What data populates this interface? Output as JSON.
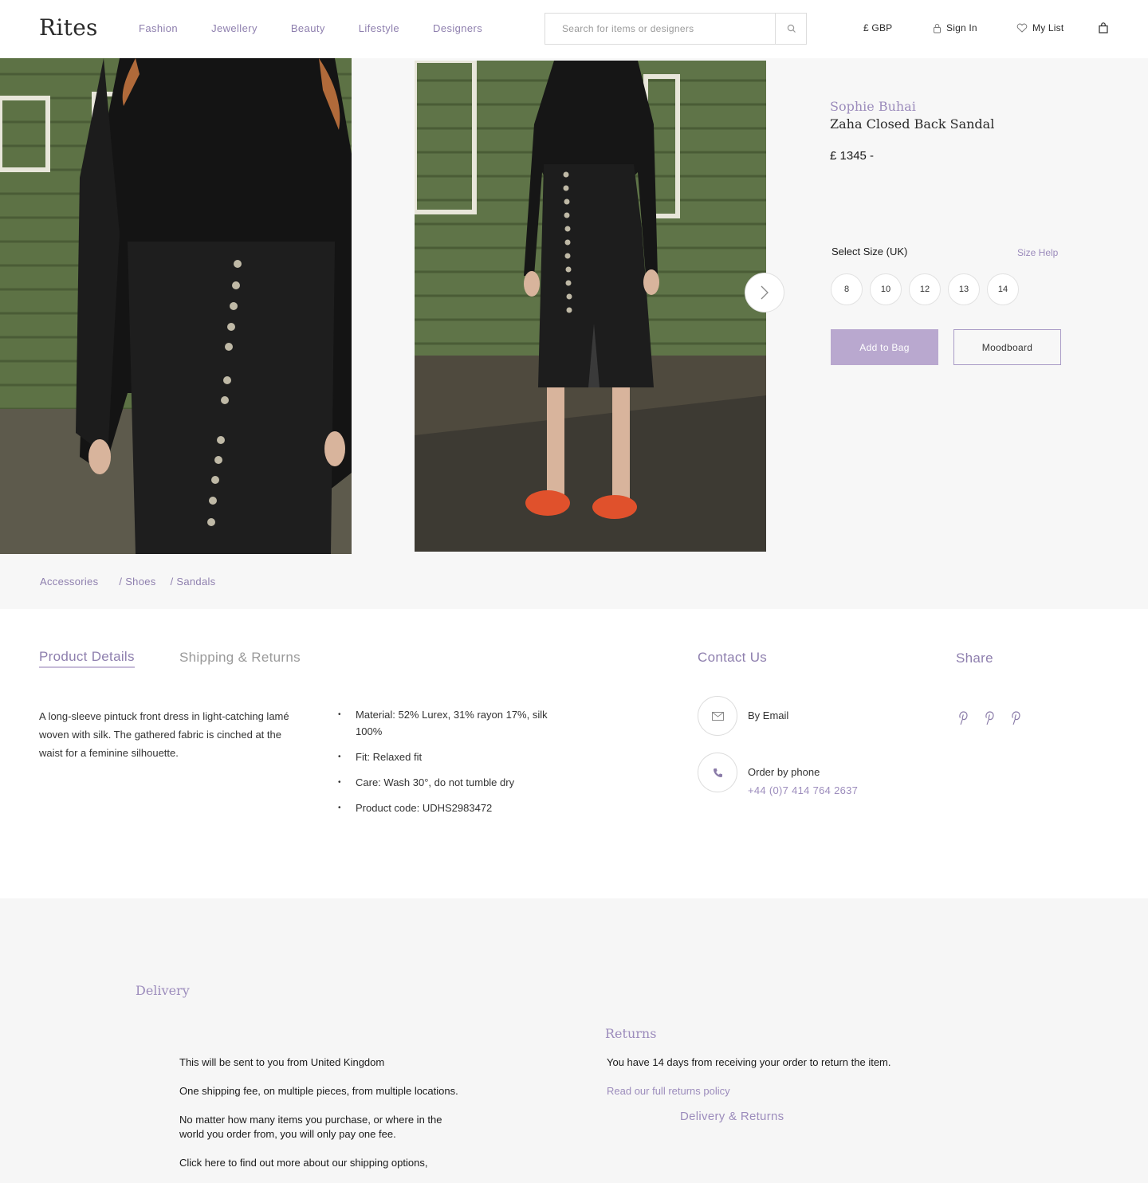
{
  "header": {
    "logo": "Rites",
    "nav": [
      "Fashion",
      "Jewellery",
      "Beauty",
      "Lifestyle",
      "Designers"
    ],
    "search_placeholder": "Search for items or designers",
    "currency": "£ GBP",
    "sign_in": "Sign In",
    "my_list": "My List"
  },
  "product": {
    "designer": "Sophie Buhai",
    "name": "Zaha Closed Back Sandal",
    "price": "£ 1345 -",
    "size_label": "Select Size (UK)",
    "size_help": "Size Help",
    "sizes": [
      "8",
      "10",
      "12",
      "13",
      "14"
    ],
    "add_to_bag": "Add to Bag",
    "moodboard": "Moodboard"
  },
  "breadcrumb": [
    "Accessories",
    "/ Shoes",
    "/ Sandals"
  ],
  "details": {
    "tab_active": "Product Details",
    "tab_other": "Shipping & Returns",
    "description": "A long-sleeve pintuck front dress in light-catching lamé woven with silk. The gathered fabric is cinched at the waist for a feminine silhouette.",
    "bullets": [
      "Material: 52% Lurex, 31% rayon 17%, silk 100%",
      "Fit:  Relaxed fit",
      "Care: Wash 30°, do not tumble dry",
      "Product code: UDHS2983472"
    ]
  },
  "contact": {
    "heading": "Contact Us",
    "email": "By Email",
    "phone_label": "Order by phone",
    "phone_number": "+44 (0)7 414 764 2637"
  },
  "share": {
    "heading": "Share",
    "icons": [
      "pinterest-icon",
      "pinterest-icon",
      "pinterest-icon"
    ]
  },
  "delivery": {
    "heading": "Delivery",
    "paragraphs": [
      "This will be sent to you from United Kingdom",
      "One shipping fee, on multiple pieces, from multiple locations.",
      "No matter how many items you purchase, or where in the world you order from, you will only pay one fee.",
      "Click here to find out more about our shipping options,"
    ]
  },
  "returns": {
    "heading": "Returns",
    "text": "You have 14 days from receiving your order to return the item.",
    "link": "Read our full returns policy",
    "delivery_returns_link": "Delivery & Returns"
  },
  "colors": {
    "accent": "#8e7fae",
    "button": "#b9a8cf",
    "wall_green": "#5d7245",
    "shoe_orange": "#e0512c"
  }
}
